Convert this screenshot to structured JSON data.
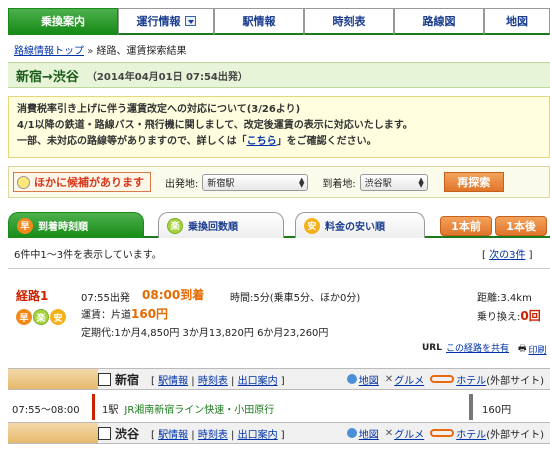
{
  "nav": {
    "tabs": [
      "乗換案内",
      "運行情報",
      "駅情報",
      "時刻表",
      "路線図",
      "地図"
    ]
  },
  "breadcrumb": {
    "home": "路線情報トップ",
    "sep": "»",
    "current": "経路、運賃探索結果"
  },
  "title": {
    "route": "新宿→渋谷",
    "datetime": "（2014年04月01日 07:54出発）"
  },
  "notice": {
    "line1": "消費税率引き上げに伴う運賃改定への対応について(3/26より)",
    "line2": "4/1以降の鉄道・路線バス・飛行機に関しまして、改定後運賃の表示に対応いたします。",
    "line3_pre": "一部、未対応の路線等がありますので、詳しくは「",
    "line3_link": "こちら",
    "line3_post": "」をご確認ください。"
  },
  "search": {
    "more_candidates": "ほかに候補があります",
    "from_label": "出発地:",
    "from_value": "新宿駅",
    "to_label": "到着地:",
    "to_value": "渋谷駅",
    "research": "再探索"
  },
  "sort": {
    "tabs": [
      {
        "icon": "早",
        "label": "到着時刻順"
      },
      {
        "icon": "楽",
        "label": "乗換回数順"
      },
      {
        "icon": "安",
        "label": "料金の安い順"
      }
    ],
    "prev": "1本前",
    "next": "1本後"
  },
  "results": {
    "count": "6件中1～3件を表示しています。",
    "next3": "次の3件"
  },
  "route1": {
    "name": "経路1",
    "icons": [
      "早",
      "楽",
      "安"
    ],
    "depart": "07:55出発",
    "arrive": "08:00到着",
    "time": "時間:5分(乗車5分、ほか0分)",
    "fare_label": "運賃：片道",
    "fare_value": "160円",
    "pass": "定期代:1か月4,850円 3か月13,820円 6か月23,260円",
    "dist_label": "距離:",
    "dist_value": "3.4km",
    "xfer_label": "乗り換え:",
    "xfer_value": "0回",
    "share_prefix": "URL",
    "share": "この経路を共有",
    "print": "印刷"
  },
  "stations": [
    {
      "name": "新宿",
      "l1": "駅情報",
      "l2": "時刻表",
      "l3": "出口案内",
      "map": "地図",
      "gourmet": "グルメ",
      "hotel": "ホテル",
      "ext": "(外部サイト)"
    },
    {
      "name": "渋谷",
      "l1": "駅情報",
      "l2": "時刻表",
      "l3": "出口案内",
      "map": "地図",
      "gourmet": "グルメ",
      "hotel": "ホテル",
      "ext": "(外部サイト)"
    }
  ],
  "segment": {
    "time": "07:55～08:00",
    "stops": "1駅",
    "line": "JR湘南新宿ライン快速・小田原行",
    "fare": "160円"
  },
  "colors": {
    "accent_green": "#178b17",
    "accent_orange": "#e56a00",
    "route_red": "#cc2200"
  }
}
